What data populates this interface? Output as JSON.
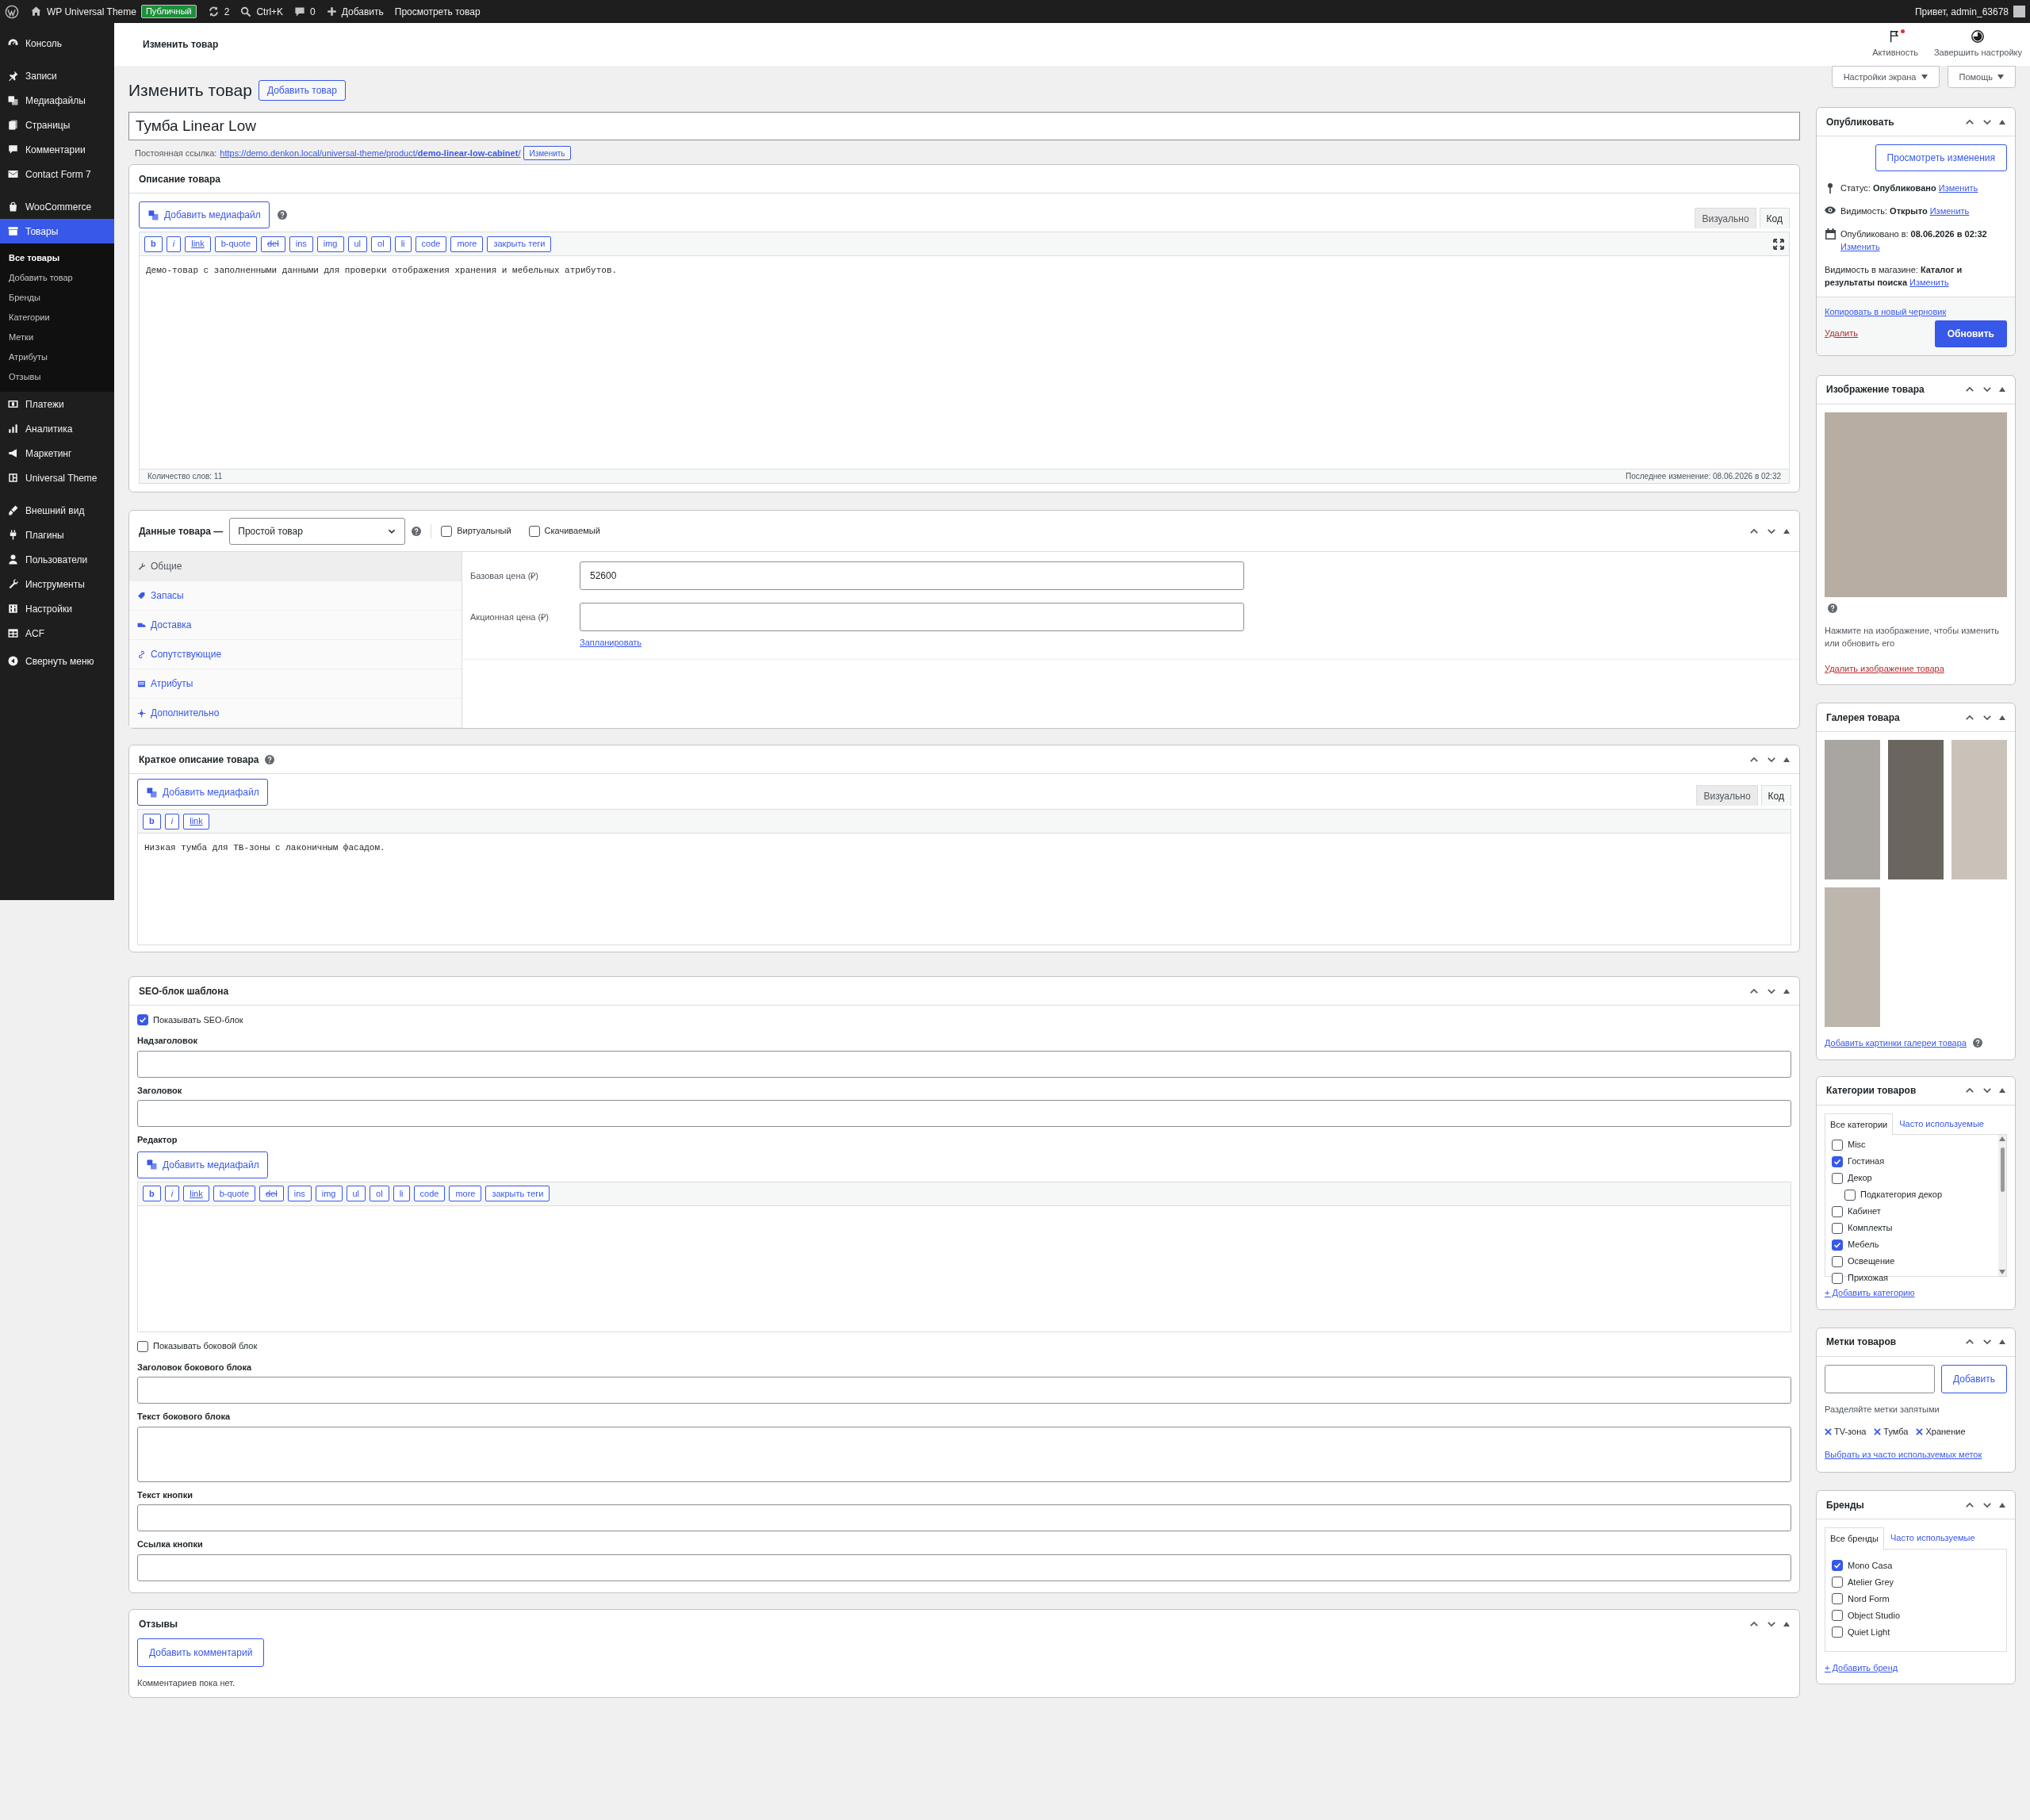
{
  "admin_bar": {
    "site": "WP Universal Theme",
    "visibility_badge": "Публичный",
    "updates": "2",
    "search": "Ctrl+K",
    "comments": "0",
    "new": "Добавить",
    "view": "Просмотреть товар",
    "greeting": "Привет, admin_63678"
  },
  "sidebar": {
    "groups": [
      [
        {
          "label": "Консоль",
          "selected": false
        }
      ],
      [
        {
          "label": "Записи",
          "selected": false
        },
        {
          "label": "Медиафайлы",
          "selected": false
        },
        {
          "label": "Страницы",
          "selected": false
        },
        {
          "label": "Комментарии",
          "selected": false
        },
        {
          "label": "Contact Form 7",
          "selected": false
        }
      ],
      [
        {
          "label": "WooCommerce",
          "selected": false
        },
        {
          "label": "Товары",
          "selected": true,
          "children": [
            {
              "label": "Все товары",
              "selected": true
            },
            {
              "label": "Добавить товар",
              "selected": false
            },
            {
              "label": "Бренды",
              "selected": false
            },
            {
              "label": "Категории",
              "selected": false
            },
            {
              "label": "Метки",
              "selected": false
            },
            {
              "label": "Атрибуты",
              "selected": false
            },
            {
              "label": "Отзывы",
              "selected": false
            }
          ]
        },
        {
          "label": "Платежи",
          "selected": false
        },
        {
          "label": "Аналитика",
          "selected": false
        },
        {
          "label": "Маркетинг",
          "selected": false
        },
        {
          "label": "Universal Theme",
          "selected": false
        }
      ],
      [
        {
          "label": "Внешний вид",
          "selected": false
        },
        {
          "label": "Плагины",
          "selected": false
        },
        {
          "label": "Пользователи",
          "selected": false
        },
        {
          "label": "Инструменты",
          "selected": false
        },
        {
          "label": "Настройки",
          "selected": false
        },
        {
          "label": "ACF",
          "selected": false
        }
      ]
    ],
    "collapse": "Свернуть меню"
  },
  "header": {
    "title": "Изменить товар",
    "actions": [
      {
        "label": "Активность",
        "has_unread": true
      },
      {
        "label": "Завершить настройку",
        "has_unread": false
      }
    ]
  },
  "screen_buttons": [
    "Настройки экрана",
    "Помощь"
  ],
  "page": {
    "title": "Изменить товар",
    "add_button": "Добавить товар",
    "post_title": "Тумба Linear Low",
    "permalink": {
      "label": "Постоянная ссылка:",
      "url": "https://demo.denkon.local/universal-theme/product/**demo-linear-low-cabinet**/",
      "button": "Изменить"
    }
  },
  "description": {
    "title": "Описание товара",
    "media_button": "Добавить медиафайл",
    "tabs": [
      {
        "label": "Визуально",
        "selected": false
      },
      {
        "label": "Код",
        "selected": true
      }
    ],
    "toolbar": [
      {
        "label": "b",
        "kind": "bold"
      },
      {
        "label": "i",
        "kind": "italic"
      },
      {
        "label": "link",
        "kind": "link"
      },
      {
        "label": "b-quote",
        "kind": "plain"
      },
      {
        "label": "del",
        "kind": "strike"
      },
      {
        "label": "ins",
        "kind": "plain"
      },
      {
        "label": "img",
        "kind": "plain"
      },
      {
        "label": "ul",
        "kind": "plain"
      },
      {
        "label": "ol",
        "kind": "plain"
      },
      {
        "label": "li",
        "kind": "plain"
      },
      {
        "label": "code",
        "kind": "plain"
      },
      {
        "label": "more",
        "kind": "plain"
      },
      {
        "label": "закрыть теги",
        "kind": "plain"
      }
    ],
    "fullscreen_toggle": true,
    "content": "Демо-товар с заполненными данными для проверки отображения хранения и мебельных атрибутов.",
    "word_count": "Количество слов: 11",
    "last_edit": "Последнее изменение: 08.06.2026 в 02:32"
  },
  "product_data": {
    "title": "Данные товара —",
    "type": "Простой товар",
    "options": [
      {
        "label": "Виртуальный",
        "checked": false
      },
      {
        "label": "Скачиваемый",
        "checked": false
      }
    ],
    "tabs": [
      {
        "label": "Общие",
        "selected": true
      },
      {
        "label": "Запасы",
        "selected": false
      },
      {
        "label": "Доставка",
        "selected": false
      },
      {
        "label": "Сопутствующие",
        "selected": false
      },
      {
        "label": "Атрибуты",
        "selected": false
      },
      {
        "label": "Дополнительно",
        "selected": false
      }
    ],
    "fields": [
      {
        "label": "Базовая цена (₽)",
        "value": "52600"
      },
      {
        "label": "Акционная цена (₽)",
        "link": "Запланировать"
      }
    ]
  },
  "short_description": {
    "title": "Краткое описание товара",
    "media_button": "Добавить медиафайл",
    "tabs": [
      {
        "label": "Визуально",
        "selected": false
      },
      {
        "label": "Код",
        "selected": true
      }
    ],
    "toolbar": [
      {
        "label": "b",
        "kind": "bold"
      },
      {
        "label": "i",
        "kind": "italic"
      },
      {
        "label": "link",
        "kind": "link"
      }
    ],
    "content": "Низкая тумба для ТВ-зоны с лаконичным фасадом."
  },
  "seo": {
    "title": "SEO-блок шаблона",
    "items": [
      {
        "kind": "checkbox",
        "label": "Показывать SEO-блок",
        "checked": true
      },
      {
        "kind": "input",
        "label": "Надзаголовок"
      },
      {
        "kind": "input",
        "label": "Заголовок"
      },
      {
        "kind": "editor",
        "label": "Редактор",
        "media_button": "Добавить медиафайл",
        "toolbar": [
          {
            "label": "b",
            "kind": "bold"
          },
          {
            "label": "i",
            "kind": "italic"
          },
          {
            "label": "link",
            "kind": "link"
          },
          {
            "label": "b-quote",
            "kind": "plain"
          },
          {
            "label": "del",
            "kind": "strike"
          },
          {
            "label": "ins",
            "kind": "plain"
          },
          {
            "label": "img",
            "kind": "plain"
          },
          {
            "label": "ul",
            "kind": "plain"
          },
          {
            "label": "ol",
            "kind": "plain"
          },
          {
            "label": "li",
            "kind": "plain"
          },
          {
            "label": "code",
            "kind": "plain"
          },
          {
            "label": "more",
            "kind": "plain"
          },
          {
            "label": "закрыть теги",
            "kind": "plain"
          }
        ]
      },
      {
        "kind": "checkbox",
        "label": "Показывать боковой блок",
        "checked": false
      },
      {
        "kind": "input",
        "label": "Заголовок бокового блока"
      },
      {
        "kind": "textarea",
        "label": "Текст бокового блока"
      },
      {
        "kind": "input",
        "label": "Текст кнопки"
      },
      {
        "kind": "input",
        "label": "Ссылка кнопки"
      }
    ]
  },
  "reviews": {
    "title": "Отзывы",
    "button": "Добавить комментарий",
    "empty": "Комментариев пока нет."
  },
  "publish": {
    "title": "Опубликовать",
    "preview_button": "Просмотреть изменения",
    "rows": [
      {
        "kind": "status",
        "label": "Статус:",
        "value": "Опубликовано",
        "link": "Изменить"
      },
      {
        "kind": "visibility",
        "label": "Видимость:",
        "value": "Открыто",
        "link": "Изменить"
      },
      {
        "kind": "date",
        "label": "Опубликовано в:",
        "value": "08.06.2026 в 02:32",
        "link": "Изменить"
      },
      {
        "kind": "catalog",
        "label": "Видимость в магазине:",
        "value": "Каталог и результаты поиска",
        "link": "Изменить"
      }
    ],
    "copy_link": "Копировать в новый черновик",
    "delete_link": "Удалить",
    "update_button": "Обновить"
  },
  "product_image": {
    "title": "Изображение товара",
    "hint": "Нажмите на изображение, чтобы изменить или обновить его",
    "remove_link": "Удалить изображение товара"
  },
  "gallery": {
    "title": "Галерея товара",
    "add_link": "Добавить картинки галереи товара"
  },
  "categories": {
    "title": "Категории товаров",
    "tabs": [
      {
        "label": "Все категории",
        "selected": true
      },
      {
        "label": "Часто используемые",
        "selected": false
      }
    ],
    "items": [
      {
        "label": "Misc",
        "checked": false
      },
      {
        "label": "Гостиная",
        "checked": true
      },
      {
        "label": "Декор",
        "checked": false,
        "children": [
          {
            "label": "Подкатегория декор",
            "checked": false
          }
        ]
      },
      {
        "label": "Кабинет",
        "checked": false
      },
      {
        "label": "Комплекты",
        "checked": false
      },
      {
        "label": "Мебель",
        "checked": true
      },
      {
        "label": "Освещение",
        "checked": false
      },
      {
        "label": "Прихожая",
        "checked": false
      }
    ],
    "add_link": "+ Добавить категорию"
  },
  "tags": {
    "title": "Метки товаров",
    "button": "Добавить",
    "hint": "Разделяйте метки запятыми",
    "items": [
      "TV-зона",
      "Тумба",
      "Хранение"
    ],
    "choose_link": "Выбрать из часто используемых меток"
  },
  "brands": {
    "title": "Бренды",
    "tabs": [
      {
        "label": "Все бренды",
        "selected": true
      },
      {
        "label": "Часто используемые",
        "selected": false
      }
    ],
    "items": [
      {
        "label": "Mono Casa",
        "checked": true
      },
      {
        "label": "Atelier Grey",
        "checked": false
      },
      {
        "label": "Nord Form",
        "checked": false
      },
      {
        "label": "Object Studio",
        "checked": false
      },
      {
        "label": "Quiet Light",
        "checked": false
      }
    ],
    "add_link": "+ Добавить бренд"
  }
}
